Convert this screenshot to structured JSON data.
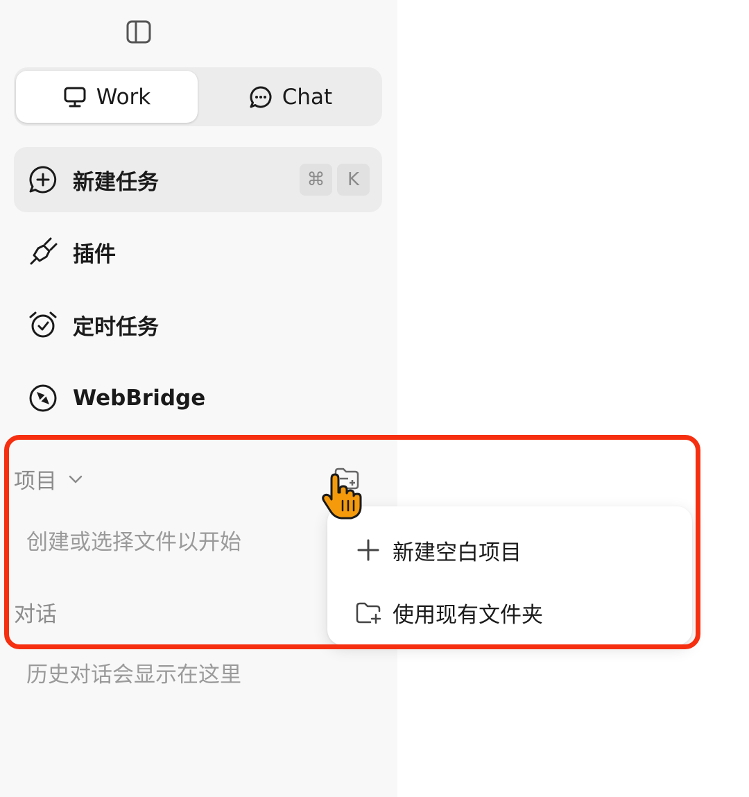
{
  "sidebar": {
    "segments": [
      {
        "label": "Work",
        "icon": "monitor-icon",
        "selected": true
      },
      {
        "label": "Chat",
        "icon": "chat-bubble-icon",
        "selected": false
      }
    ],
    "nav_items": [
      {
        "label": "新建任务",
        "icon": "new-task-icon",
        "shortcut": [
          "⌘",
          "K"
        ],
        "active": true
      },
      {
        "label": "插件",
        "icon": "plug-icon"
      },
      {
        "label": "定时任务",
        "icon": "alarm-clock-icon"
      },
      {
        "label": "WebBridge",
        "icon": "webbridge-icon"
      }
    ],
    "projects": {
      "title": "项目",
      "empty_text": "创建或选择文件以开始"
    },
    "conversations": {
      "title": "对话",
      "empty_text": "历史对话会显示在这里"
    }
  },
  "dropdown_menu": {
    "items": [
      {
        "label": "新建空白项目",
        "icon": "plus-icon"
      },
      {
        "label": "使用现有文件夹",
        "icon": "folder-plus-icon"
      }
    ]
  },
  "colors": {
    "highlight_border": "#f52f10",
    "sidebar_bg": "#f8f8f8",
    "cursor": "#f59a0a"
  }
}
